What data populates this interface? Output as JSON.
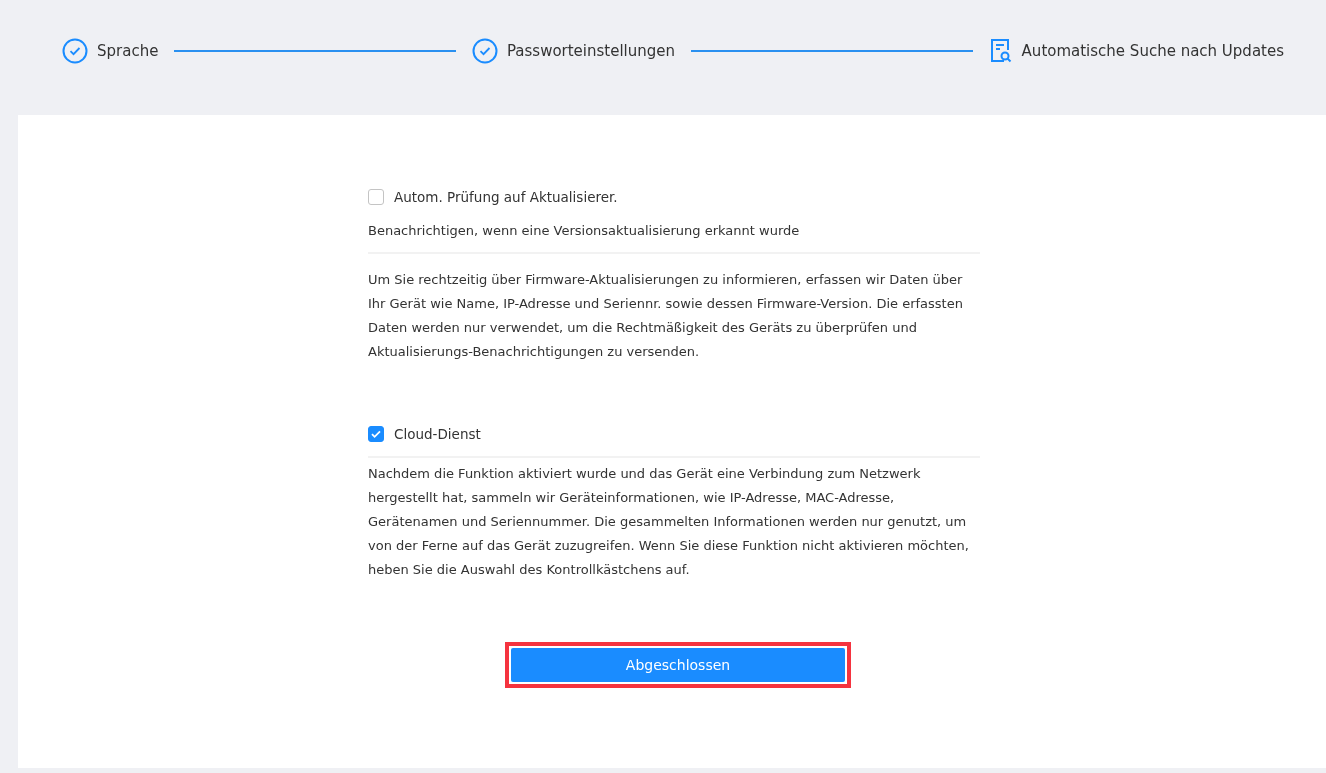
{
  "steps": [
    {
      "label": "Sprache",
      "completed": true
    },
    {
      "label": "Passworteinstellungen",
      "completed": true
    },
    {
      "label": "Automatische Suche nach Updates",
      "completed": false
    }
  ],
  "sections": [
    {
      "label": "Autom. Prüfung auf Aktualisierer.",
      "checked": false,
      "subtitle": "Benachrichtigen, wenn eine Versionsaktualisierung erkannt wurde",
      "description": "Um Sie rechtzeitig über Firmware-Aktualisierungen zu informieren, erfassen wir Daten über Ihr Gerät wie Name, IP-Adresse und Seriennr. sowie dessen Firmware-Version. Die erfassten Daten werden nur verwendet, um die Rechtmäßigkeit des Geräts zu überprüfen und Aktualisierungs-Benachrichtigungen zu versenden."
    },
    {
      "label": "Cloud-Dienst",
      "checked": true,
      "description": "Nachdem die Funktion aktiviert wurde und das Gerät eine Verbindung zum Netzwerk hergestellt hat, sammeln wir Geräteinformationen, wie IP-Adresse, MAC-Adresse, Gerätenamen und Seriennummer. Die gesammelten Informationen werden nur genutzt, um von der Ferne auf das Gerät zuzugreifen. Wenn Sie diese Funktion nicht aktivieren möchten, heben Sie die Auswahl des Kontrollkästchens auf."
    }
  ],
  "finish_button": {
    "label": "Abgeschlossen",
    "highlighted": true
  }
}
